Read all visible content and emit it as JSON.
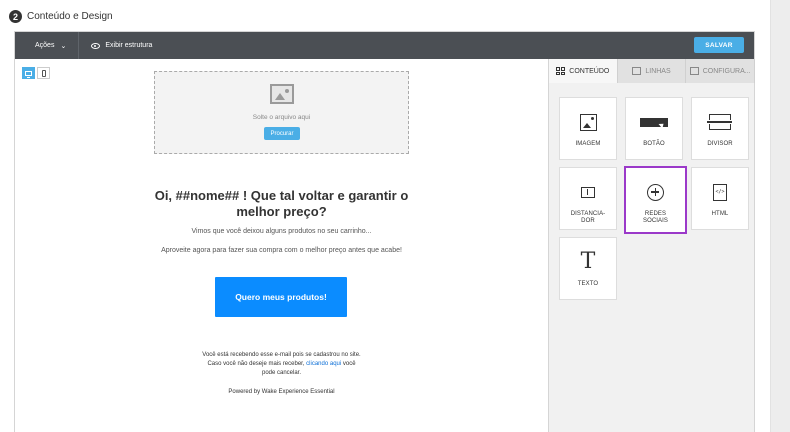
{
  "step": {
    "number": "2",
    "title": "Conteúdo e Design"
  },
  "toolbar": {
    "actions_label": "Ações",
    "actions_chevron": "⌄",
    "structure_label": "Exibir estrutura",
    "save_label": "SALVAR"
  },
  "canvas": {
    "dropzone_text": "Solte o arquivo aqui",
    "browse_label": "Procurar",
    "headline": "Oi, ##nome## ! Que tal voltar e garantir o melhor preço?",
    "paragraph_1": "Vimos que você deixou alguns produtos no seu carrinho...",
    "paragraph_2": "Aproveite agora para fazer sua compra com o melhor preço antes que acabe!",
    "cta_label": "Quero meus produtos!",
    "footer_line_1": "Você está recebendo esse e-mail pois se cadastrou no site.",
    "footer_line_2_pre": "Caso você não deseje mais receber, ",
    "footer_link": "clicando aqui",
    "footer_line_2_post": " você",
    "footer_line_3": "pode cancelar.",
    "powered_by": "Powered by Wake Experience Essential"
  },
  "panel": {
    "tabs": [
      {
        "label": "CONTEÚDO",
        "icon": "grid-icon"
      },
      {
        "label": "LINHAS",
        "icon": "rows-icon"
      },
      {
        "label": "CONFIGURA...",
        "icon": "settings-icon"
      }
    ],
    "blocks": [
      {
        "label": "IMAGEM",
        "icon": "image-icon"
      },
      {
        "label": "BOTÃO",
        "icon": "button-icon"
      },
      {
        "label": "DIVISOR",
        "icon": "divider-icon"
      },
      {
        "label_1": "DISTANCIA-",
        "label_2": "DOR",
        "icon": "spacer-icon"
      },
      {
        "label_1": "REDES",
        "label_2": "SOCIAIS",
        "icon": "social-icon"
      },
      {
        "label": "HTML",
        "icon": "html-icon"
      },
      {
        "label": "TEXTO",
        "icon": "text-icon",
        "glyph": "T"
      }
    ],
    "html_glyph": "</>"
  },
  "colors": {
    "accent": "#4aaee6",
    "cta": "#0b8cff",
    "toolbar": "#4b4f54",
    "selected_border": "#9b39c9"
  }
}
